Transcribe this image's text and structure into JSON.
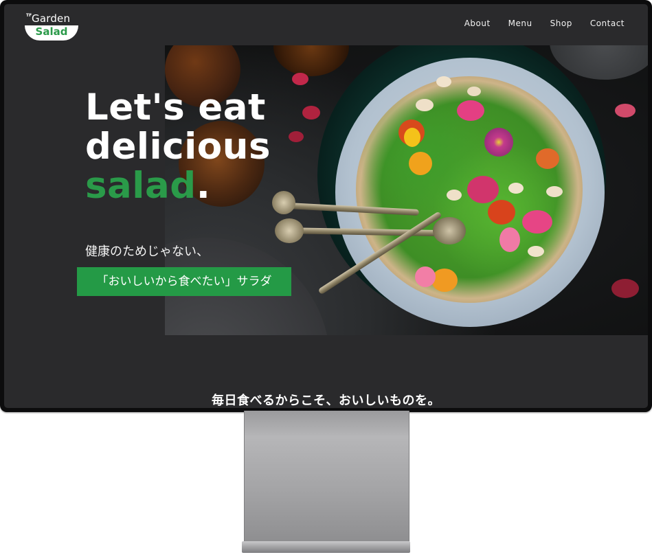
{
  "brand": {
    "prefix": "TF",
    "name_top": "Garden",
    "name_bottom": "Salad",
    "accent_color": "#2a9a49"
  },
  "nav": {
    "items": [
      {
        "label": "About"
      },
      {
        "label": "Menu"
      },
      {
        "label": "Shop"
      },
      {
        "label": "Contact"
      }
    ]
  },
  "hero": {
    "title_line1": "Let's eat",
    "title_line2": "delicious",
    "title_line3_green": "salad",
    "title_period": ".",
    "subtitle": "健康のためじゃない、",
    "highlight": "「おいしいから食べたい」サラダ",
    "image": "salad-bowl-photo"
  },
  "section": {
    "heading": "毎日食べるからこそ、おいしいものを。"
  },
  "colors": {
    "screen_bg": "#2a2a2c",
    "highlight_bg": "#249a46"
  }
}
